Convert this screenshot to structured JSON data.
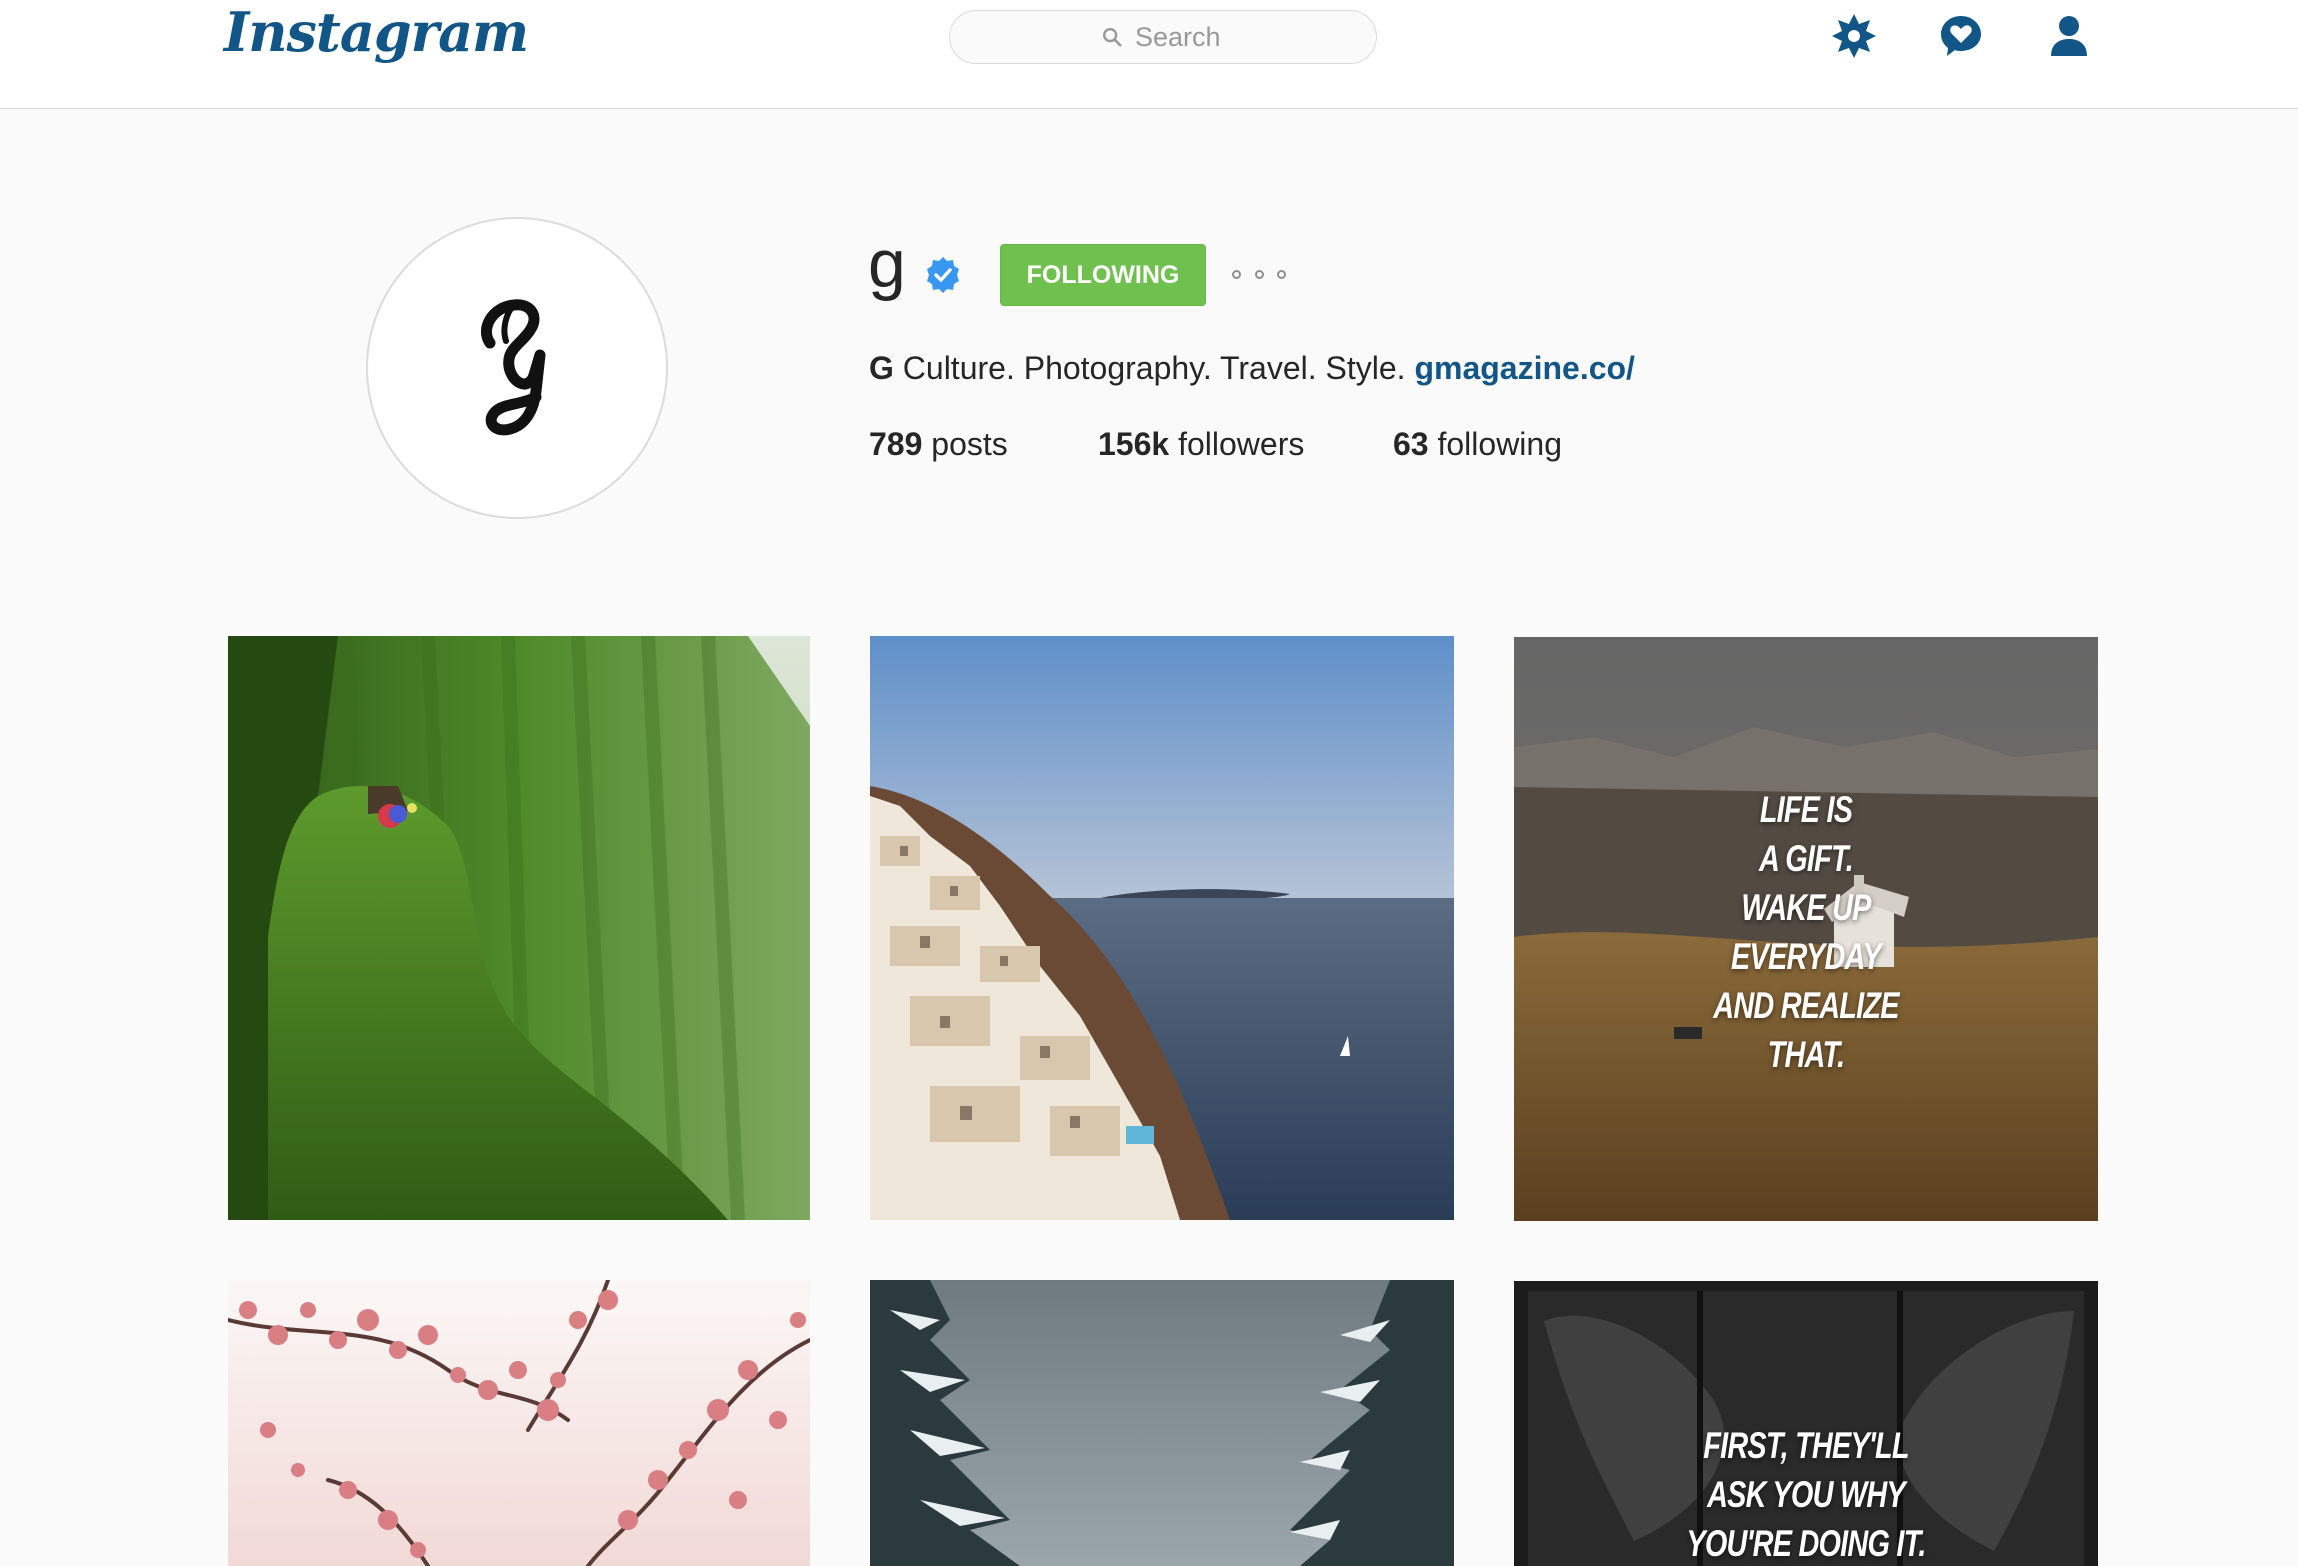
{
  "header": {
    "logo": "Instagram",
    "search_placeholder": "Search",
    "icons": [
      "explore-icon",
      "activity-heart-icon",
      "profile-icon"
    ]
  },
  "profile": {
    "username": "g",
    "verified": true,
    "follow_button_label": "FOLLOWING",
    "follow_button_color": "#70c050",
    "avatar_letter": "G",
    "bio_name": "G",
    "bio_text": "Culture. Photography. Travel. Style.",
    "bio_link": "gmagazine.co/",
    "link_color": "#125688",
    "stats": {
      "posts_count": "789",
      "posts_label": "posts",
      "followers_count": "156k",
      "followers_label": "followers",
      "following_count": "63",
      "following_label": "following"
    }
  },
  "posts": [
    {
      "scene": "green-cliff"
    },
    {
      "scene": "santorini-sunset"
    },
    {
      "scene": "mountain-house",
      "quote_lines": [
        "LIFE IS",
        "A GIFT.",
        "WAKE UP",
        "EVERYDAY",
        "AND REALIZE",
        "THAT."
      ]
    },
    {
      "scene": "cherry-blossom"
    },
    {
      "scene": "snowy-trees"
    },
    {
      "scene": "dark-window",
      "quote_lines": [
        "FIRST, THEY'LL",
        "ASK YOU WHY",
        "YOU'RE DOING IT."
      ]
    }
  ]
}
